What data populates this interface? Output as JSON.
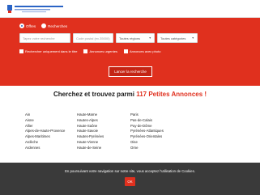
{
  "logo": {
    "name": "logo-mark"
  },
  "search": {
    "radios": [
      {
        "label": "Offres",
        "checked": true
      },
      {
        "label": "Recherches",
        "checked": false
      }
    ],
    "keyword_placeholder": "Tapez votre recherche",
    "zip_placeholder": "Code postal (ex.35000)",
    "region_value": "Toutes régions",
    "category_value": "Toutes catégories",
    "checkboxes": [
      {
        "label": "Rechercher uniquement dans le titre"
      },
      {
        "label": "Annonces urgentes"
      },
      {
        "label": "Annonces avec photo"
      }
    ],
    "submit_label": "Lancer la recherche"
  },
  "headline": {
    "prefix": "Cherchez et trouvez parmi",
    "count": "117 Petites Annonces !"
  },
  "departments": {
    "col1": [
      "Ain",
      "Aisne",
      "Allier",
      "Alpes-de-Haute-Provence",
      "Alpes-Maritimes",
      "Ardèche",
      "Ardennes"
    ],
    "col2": [
      "Haute-Marne",
      "Hautes-Alpes",
      "Haute-Saône",
      "Haute-Savoie",
      "Hautes-Pyrénées",
      "Haute-Vienne",
      "Haute-de-Seine"
    ],
    "col3": [
      "Paris",
      "Pas-de-Calais",
      "Puy-de-Dôme",
      "Pyrénées-Atlantiques",
      "Pyrénées-Orientales",
      "Oise",
      "Orne"
    ]
  },
  "cookie": {
    "text": "En poursuivant votre navigation sur notre site, vous acceptez l'utilisation de Cookies.",
    "ok_label": "OK"
  },
  "colors": {
    "brand_red": "#e0301e",
    "cookie_bg": "#3a3a3a"
  }
}
